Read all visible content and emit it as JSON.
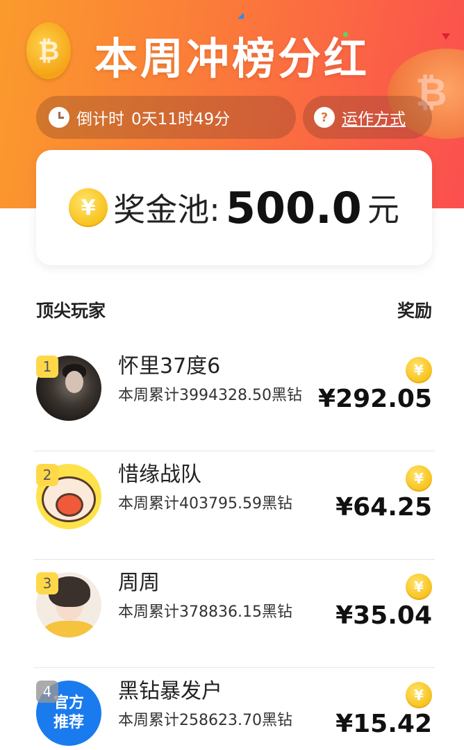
{
  "header": {
    "title": "本周冲榜分红",
    "countdown_label": "倒计时",
    "countdown_value": "0天11时49分",
    "howto_label": "运作方式"
  },
  "pool": {
    "label": "奖金池:",
    "amount": "500.0",
    "unit": "元"
  },
  "list": {
    "left_header": "顶尖玩家",
    "right_header": "奖励",
    "players": [
      {
        "rank": "1",
        "name": "怀里37度6",
        "total": "本周累计3994328.50黑钻",
        "reward": "¥292.05"
      },
      {
        "rank": "2",
        "name": "惜缘战队",
        "total": "本周累计403795.59黑钻",
        "reward": "¥64.25"
      },
      {
        "rank": "3",
        "name": "周周",
        "total": "本周累计378836.15黑钻",
        "reward": "¥35.04"
      },
      {
        "rank": "4",
        "name": "黑钻暴发户",
        "total": "本周累计258623.70黑钻",
        "reward": "¥15.42",
        "avatar_text_1": "官方",
        "avatar_text_2": "推荐"
      }
    ]
  },
  "icons": {
    "coin_symbol": "¥",
    "help_symbol": "?"
  },
  "colors": {
    "hero_start": "#fb9b2c",
    "hero_end": "#fb4f4f",
    "badge_yellow": "#ffd84a",
    "coin_gold": "#f7c21c",
    "official_blue": "#1a7bef"
  }
}
